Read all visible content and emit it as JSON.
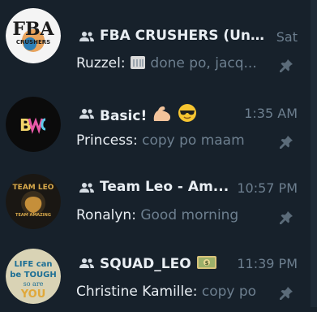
{
  "chats": [
    {
      "title": "FBA CRUSHERS (Uno...",
      "time": "Sat",
      "sender": "Ruzzel:",
      "message": "done po, jacq...",
      "avatar_text": "FBA",
      "avatar_subtext": "CRUSHERS"
    },
    {
      "title": "Basic!",
      "time": "1:35 AM",
      "sender": "Princess:",
      "message": "copy po maam",
      "avatar_text": "B"
    },
    {
      "title": "Team Leo - Am...",
      "time": "10:57 PM",
      "sender": "Ronalyn:",
      "message": "Good morning",
      "avatar_text": "TEAM LEO",
      "avatar_subtext": "TEAM AMAZING"
    },
    {
      "title": "SQUAD_LEO",
      "time": "11:39 PM",
      "sender": "Christine Kamille:",
      "message": "copy po",
      "avatar_lines": [
        "LIFE can",
        "be TOUGH",
        "so are",
        "YOU"
      ]
    }
  ],
  "colors": {
    "background": "#17212b",
    "title": "#e9eef3",
    "muted": "#6d7f8f",
    "scrollbar": "#1e2a36"
  }
}
